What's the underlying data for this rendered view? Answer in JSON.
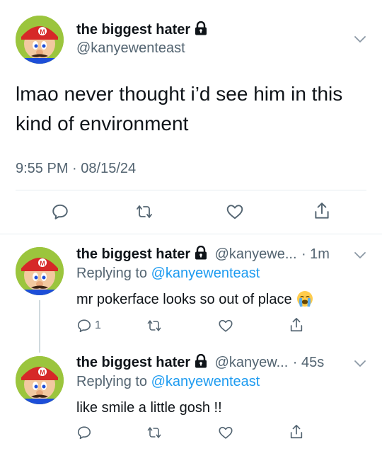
{
  "main_tweet": {
    "display_name": "the biggest hater",
    "handle": "@kanyewenteast",
    "text": "lmao never thought i’d see him in this kind of environment",
    "time": "9:55 PM",
    "sep": "·",
    "date": "08/15/24"
  },
  "reply1": {
    "display_name": "the biggest hater",
    "handle": "@kanyewe...",
    "time": "· 1m",
    "replying_label": "Replying to",
    "replying_handle": "@kanyewenteast",
    "text": "mr pokerface looks so out of place",
    "reply_count": "1"
  },
  "reply2": {
    "display_name": "the biggest hater",
    "handle": "@kanyew...",
    "time": "· 45s",
    "replying_label": "Replying to",
    "replying_handle": "@kanyewenteast",
    "text": "like smile a little gosh !!"
  },
  "colors": {
    "link": "#1d9bf0",
    "secondary_text": "#536471",
    "primary_text": "#0f1419"
  },
  "icons": [
    "lock-icon",
    "chevron-down-icon",
    "reply-icon",
    "retweet-icon",
    "like-icon",
    "share-icon",
    "crying-emoji"
  ]
}
